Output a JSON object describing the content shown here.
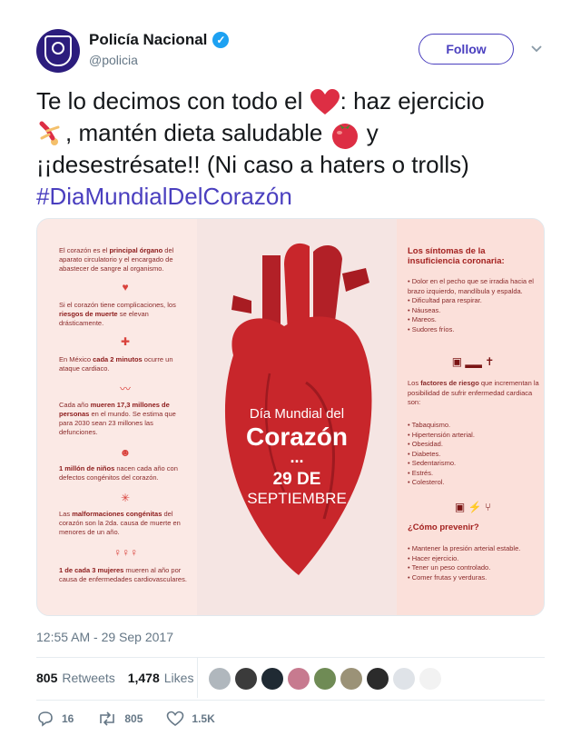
{
  "account": {
    "name": "Policía Nacional",
    "handle": "@policia",
    "follow_label": "Follow"
  },
  "tweet": {
    "line1_a": "Te lo decimos con todo el ",
    "line1_b": ": haz ejercicio",
    "line2": ", mantén dieta saludable ",
    "line2_b": " y",
    "line3": "¡¡desestrésate!! (Ni caso a haters o trolls)",
    "hashtag": "#DiaMundialDelCorazón"
  },
  "infographic": {
    "left": [
      {
        "pre": "El corazón es el ",
        "bold": "principal órgano",
        "post": " del aparato circulatorio y el encargado de abastecer de sangre al organismo."
      },
      {
        "pre": "Si el corazón tiene complicaciones, los ",
        "bold": "riesgos de muerte",
        "post": " se elevan drásticamente."
      },
      {
        "pre": "En México ",
        "bold": "cada 2 minutos",
        "post": " ocurre un ataque cardiaco."
      },
      {
        "pre": "Cada año ",
        "bold": "mueren 17,3 millones de personas",
        "post": " en el mundo. Se estima que para 2030 sean 23 millones las defunciones."
      },
      {
        "pre": "",
        "bold": "1 millón de niños",
        "post": " nacen cada año con defectos congénitos del corazón."
      },
      {
        "pre": "Las ",
        "bold": "malformaciones congénitas",
        "post": " del corazón son la 2da. causa de muerte en menores de un año."
      },
      {
        "pre": "",
        "bold": "1 de cada 3 mujeres",
        "post": " mueren al año por causa de enfermedades cardiovasculares."
      }
    ],
    "center": {
      "title_a": "Día Mundial del",
      "title_b": "Corazón",
      "dots": "...",
      "date_a": "29 DE",
      "date_b": "SEPTIEMBRE"
    },
    "right": {
      "symptoms_title": "Los síntomas de la insuficiencia coronaria:",
      "symptoms": [
        "• Dolor en el pecho que se irradia hacia el brazo izquierdo, mandíbula y espalda.",
        "• Dificultad para respirar.",
        "• Náuseas.",
        "• Mareos.",
        "• Sudores fríos."
      ],
      "risk_intro_a": "Los ",
      "risk_intro_bold": "factores de riesgo",
      "risk_intro_b": " que incrementan la posibilidad de sufrir enfermedad cardiaca son:",
      "risks": [
        "• Tabaquismo.",
        "• Hipertensión arterial.",
        "• Obesidad.",
        "• Diabetes.",
        "• Sedentarismo.",
        "• Estrés.",
        "• Colesterol."
      ],
      "prevent_title": "¿Cómo prevenir?",
      "prevent": [
        "• Mantener la presión arterial estable.",
        "• Hacer ejercicio.",
        "• Tener un peso controlado.",
        "• Comer frutas y verduras."
      ]
    },
    "colors": {
      "heart": "#c8262b",
      "accent": "#d9423c",
      "text": "#8c1a1a"
    }
  },
  "timestamp": "12:55 AM - 29 Sep 2017",
  "stats": {
    "retweets_count": "805",
    "retweets_label": "Retweets",
    "likes_count": "1,478",
    "likes_label": "Likes"
  },
  "likers": [
    "#b0b7bd",
    "#3b3b3b",
    "#1f2a33",
    "#c77a8f",
    "#6f8b55",
    "#9b9277",
    "#2b2b2b",
    "#dfe3e8",
    "#f2f2f2"
  ],
  "actions": {
    "replies": "16",
    "retweets": "805",
    "likes": "1.5K"
  },
  "brand": {
    "accent": "#4a3fbf",
    "verified": "#1da1f2"
  }
}
